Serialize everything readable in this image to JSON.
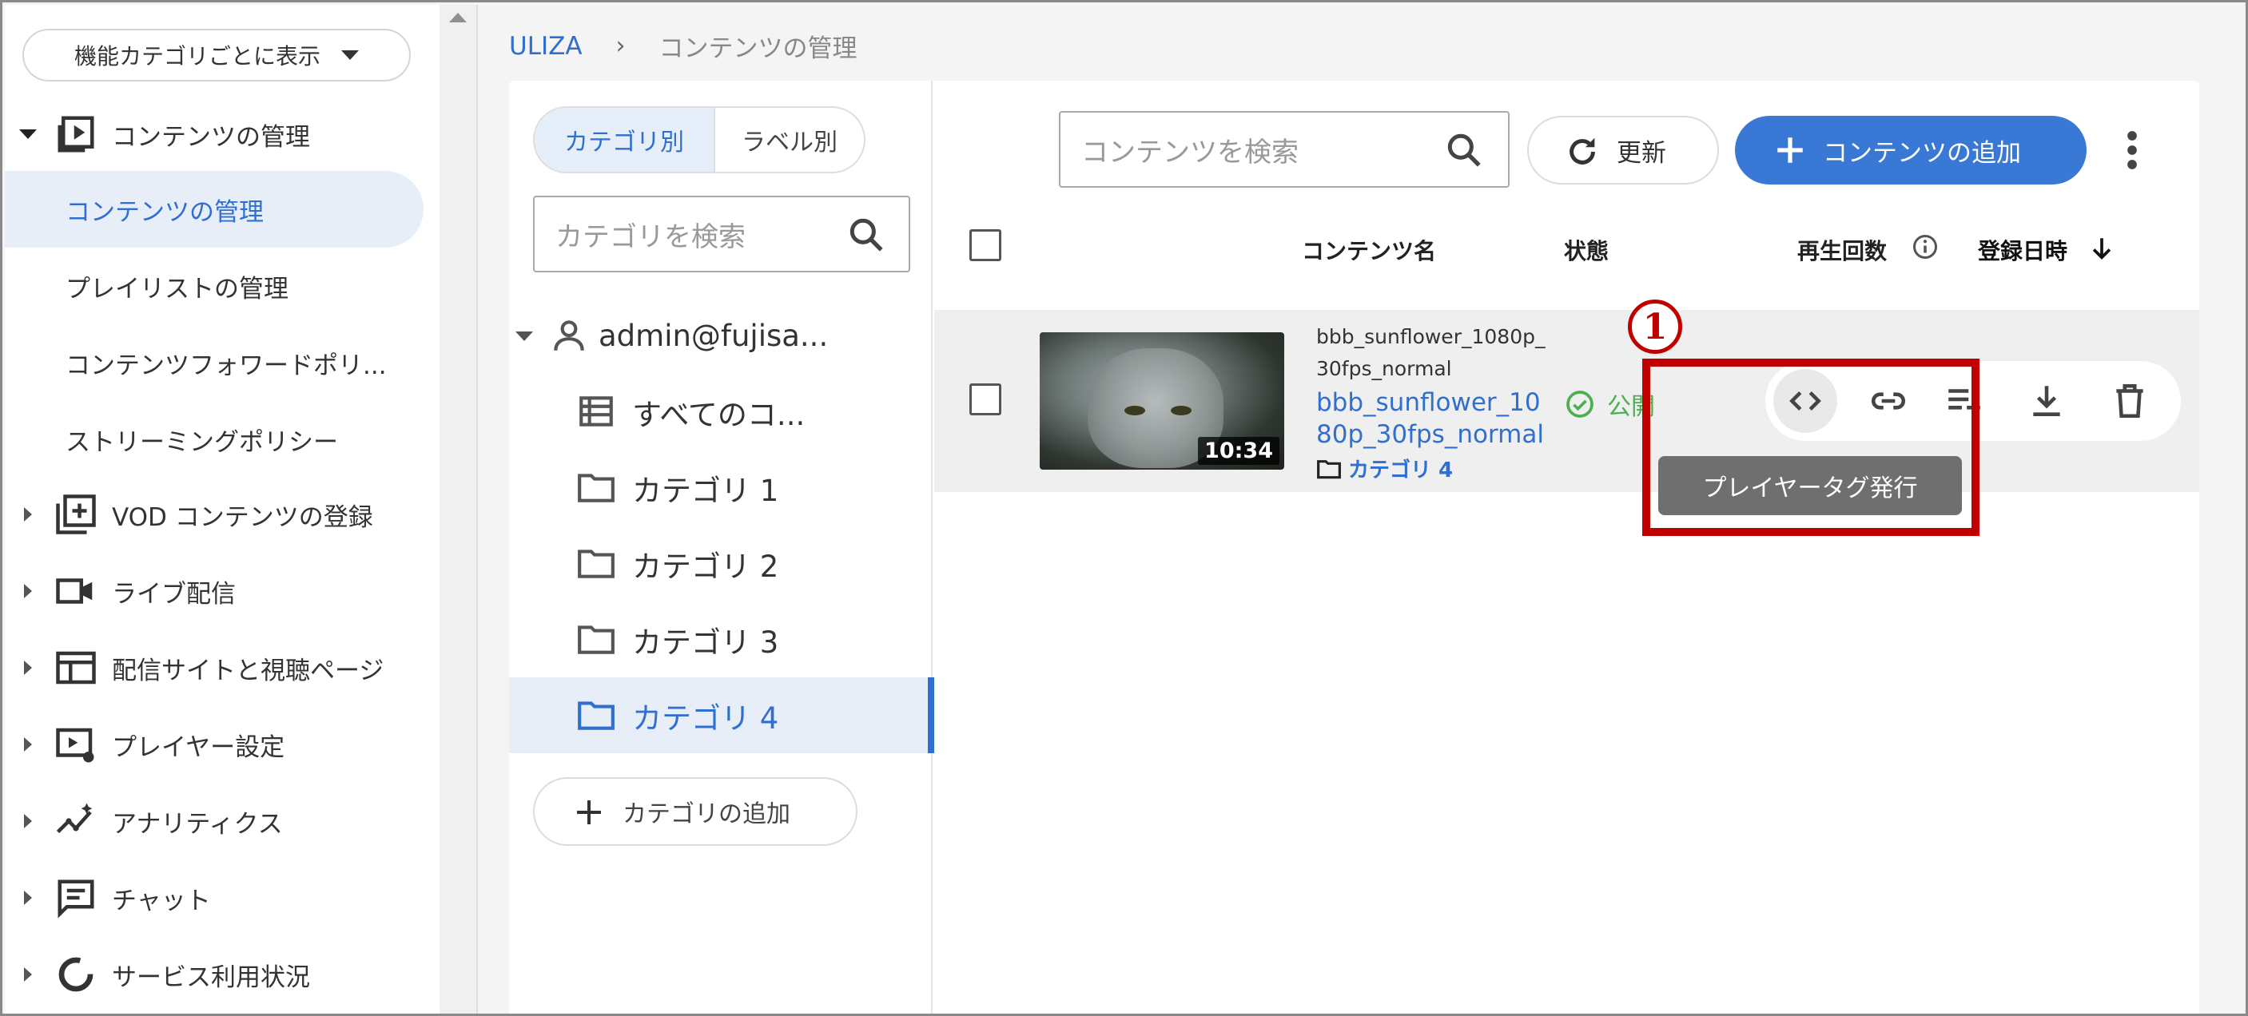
{
  "sidebar": {
    "view_select": "機能カテゴリごとに表示",
    "content_management": "コンテンツの管理",
    "sub_items": [
      "コンテンツの管理",
      "プレイリストの管理",
      "コンテンツフォワードポリ...",
      "ストリーミングポリシー"
    ],
    "groups": [
      "VOD コンテンツの登録",
      "ライブ配信",
      "配信サイトと視聴ページ",
      "プレイヤー設定",
      "アナリティクス",
      "チャット",
      "サービス利用状況"
    ]
  },
  "breadcrumb": {
    "home": "ULIZA",
    "separator": "›",
    "current": "コンテンツの管理"
  },
  "category_panel": {
    "tab_category": "カテゴリ別",
    "tab_label": "ラベル別",
    "search_placeholder": "カテゴリを検索",
    "account": "admin@fujisa...",
    "all_contents": "すべてのコ...",
    "categories": [
      "カテゴリ 1",
      "カテゴリ 2",
      "カテゴリ 3",
      "カテゴリ 4"
    ],
    "add_button": "カテゴリの追加"
  },
  "toolbar": {
    "search_placeholder": "コンテンツを検索",
    "refresh_label": "更新",
    "add_label": "コンテンツの追加"
  },
  "table": {
    "headers": {
      "name": "コンテンツ名",
      "status": "状態",
      "plays": "再生回数",
      "date": "登録日時"
    },
    "row": {
      "duration": "10:34",
      "file_name": "bbb_sunflower_1080p_30fps_normal",
      "title": "bbb_sunflower_1080p_30fps_normal",
      "category": "カテゴリ 4",
      "status": "公開"
    }
  },
  "tooltip": "プレイヤータグ発行",
  "annotation_marker": "1",
  "colors": {
    "accent": "#3a78d6",
    "highlight": "#c00000",
    "status_ok": "#4caf50"
  }
}
